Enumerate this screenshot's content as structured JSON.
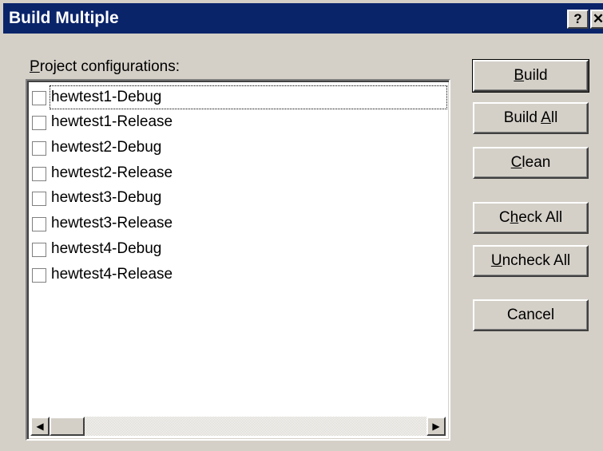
{
  "window": {
    "title": "Build Multiple",
    "help_glyph": "?",
    "close_glyph": "✕"
  },
  "list": {
    "label_prefix": "",
    "label_underlined": "P",
    "label_rest": "roject configurations:",
    "items": [
      {
        "label": "hewtest1-Debug",
        "checked": false
      },
      {
        "label": "hewtest1-Release",
        "checked": false
      },
      {
        "label": "hewtest2-Debug",
        "checked": false
      },
      {
        "label": "hewtest2-Release",
        "checked": false
      },
      {
        "label": "hewtest3-Debug",
        "checked": false
      },
      {
        "label": "hewtest3-Release",
        "checked": false
      },
      {
        "label": "hewtest4-Debug",
        "checked": false
      },
      {
        "label": "hewtest4-Release",
        "checked": false
      }
    ],
    "scroll_left_glyph": "◀",
    "scroll_right_glyph": "▶"
  },
  "buttons": {
    "build": {
      "pre": "",
      "u": "B",
      "post": "uild"
    },
    "build_all": {
      "pre": "Build ",
      "u": "A",
      "post": "ll"
    },
    "clean": {
      "pre": "",
      "u": "C",
      "post": "lean"
    },
    "check_all": {
      "pre": "C",
      "u": "h",
      "post": "eck All"
    },
    "uncheck_all": {
      "pre": "",
      "u": "U",
      "post": "ncheck All"
    },
    "cancel": {
      "pre": "Cancel",
      "u": "",
      "post": ""
    }
  }
}
